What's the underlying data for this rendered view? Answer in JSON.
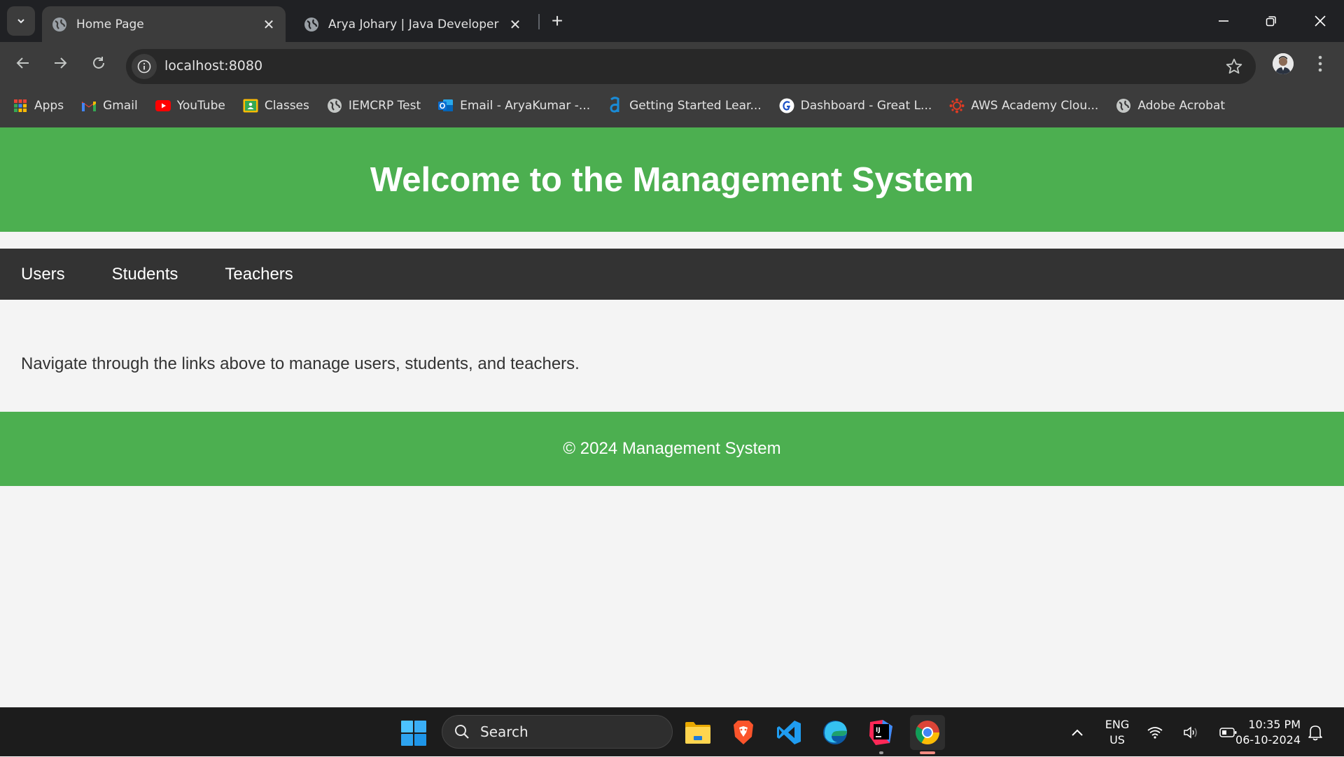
{
  "browser": {
    "tabs": [
      {
        "title": "Home Page",
        "active": true,
        "icon": "globe-icon"
      },
      {
        "title": "Arya Johary | Java Developer",
        "active": false,
        "icon": "globe-icon"
      }
    ],
    "new_tab_label": "+",
    "address_bar": {
      "url": "localhost:8080"
    },
    "bookmarks": [
      {
        "label": "Apps",
        "icon": "apps-grid-icon"
      },
      {
        "label": "Gmail",
        "icon": "gmail-icon"
      },
      {
        "label": "YouTube",
        "icon": "youtube-icon"
      },
      {
        "label": "Classes",
        "icon": "google-classroom-icon"
      },
      {
        "label": "IEMCRP Test",
        "icon": "globe-icon"
      },
      {
        "label": "Email - AryaKumar -...",
        "icon": "outlook-icon"
      },
      {
        "label": "Getting Started Lear...",
        "icon": "amazon-a-icon"
      },
      {
        "label": "Dashboard - Great L...",
        "icon": "great-learning-icon"
      },
      {
        "label": "AWS Academy Clou...",
        "icon": "canvas-icon"
      },
      {
        "label": "Adobe Acrobat",
        "icon": "globe-icon"
      }
    ]
  },
  "page": {
    "header_title": "Welcome to the Management System",
    "nav_links": [
      "Users",
      "Students",
      "Teachers"
    ],
    "intro_text": "Navigate through the links above to manage users, students, and teachers.",
    "footer_text": "© 2024 Management System",
    "colors": {
      "primary_green": "#4caf50",
      "nav_dark": "#333333",
      "background": "#f4f4f4"
    }
  },
  "taskbar": {
    "search_placeholder": "Search",
    "apps": [
      "file-explorer",
      "brave",
      "vscode",
      "edge",
      "intellij",
      "chrome"
    ],
    "language": {
      "line1": "ENG",
      "line2": "US"
    },
    "time": "10:35 PM",
    "date": "06-10-2024"
  }
}
